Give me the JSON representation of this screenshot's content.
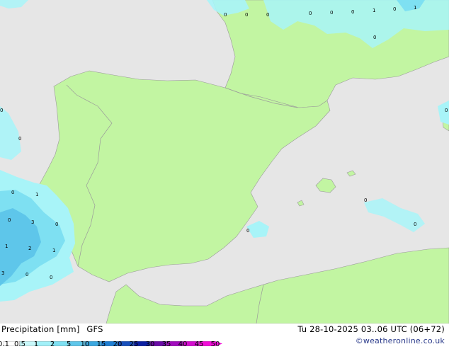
{
  "colors": {
    "sea": "#e6e6e6",
    "land": "#c2f5a2",
    "border": "#9a9a9a",
    "precip_light": "#a8f4f8",
    "precip_mid": "#7ee0f2",
    "precip_heavy": "#5ec6ea"
  },
  "precip_labels": [
    {
      "text": "0"
    },
    {
      "text": "0"
    },
    {
      "text": "0"
    },
    {
      "text": "0"
    },
    {
      "text": "0"
    },
    {
      "text": "0"
    },
    {
      "text": "1"
    },
    {
      "text": "0"
    },
    {
      "text": "1"
    },
    {
      "text": "0"
    },
    {
      "text": "0"
    },
    {
      "text": "0"
    },
    {
      "text": "0"
    },
    {
      "text": "1"
    },
    {
      "text": "0"
    },
    {
      "text": "3"
    },
    {
      "text": "0"
    },
    {
      "text": "1"
    },
    {
      "text": "2"
    },
    {
      "text": "1"
    },
    {
      "text": "3"
    },
    {
      "text": "0"
    },
    {
      "text": "0"
    },
    {
      "text": "0"
    },
    {
      "text": "0"
    },
    {
      "text": "0"
    },
    {
      "text": "0"
    }
  ],
  "footer": {
    "title": "Precipitation [mm]",
    "model": "GFS",
    "datetime": "Tu 28-10-2025 03..06 UTC (06+72)",
    "credit": "©weatheronline.co.uk"
  },
  "legend": {
    "ticks": [
      "0.1",
      "0.5",
      "1",
      "2",
      "5",
      "10",
      "15",
      "20",
      "25",
      "30",
      "35",
      "40",
      "45",
      "50"
    ],
    "colors": [
      "#ffffff",
      "#c8f8fa",
      "#a2f0f8",
      "#7ee0f2",
      "#5ec6ea",
      "#3ca8e0",
      "#1e7ed2",
      "#1850bc",
      "#0c20a2",
      "#6a0ca6",
      "#a20cbe",
      "#d40cd0",
      "#f20cd8"
    ]
  }
}
